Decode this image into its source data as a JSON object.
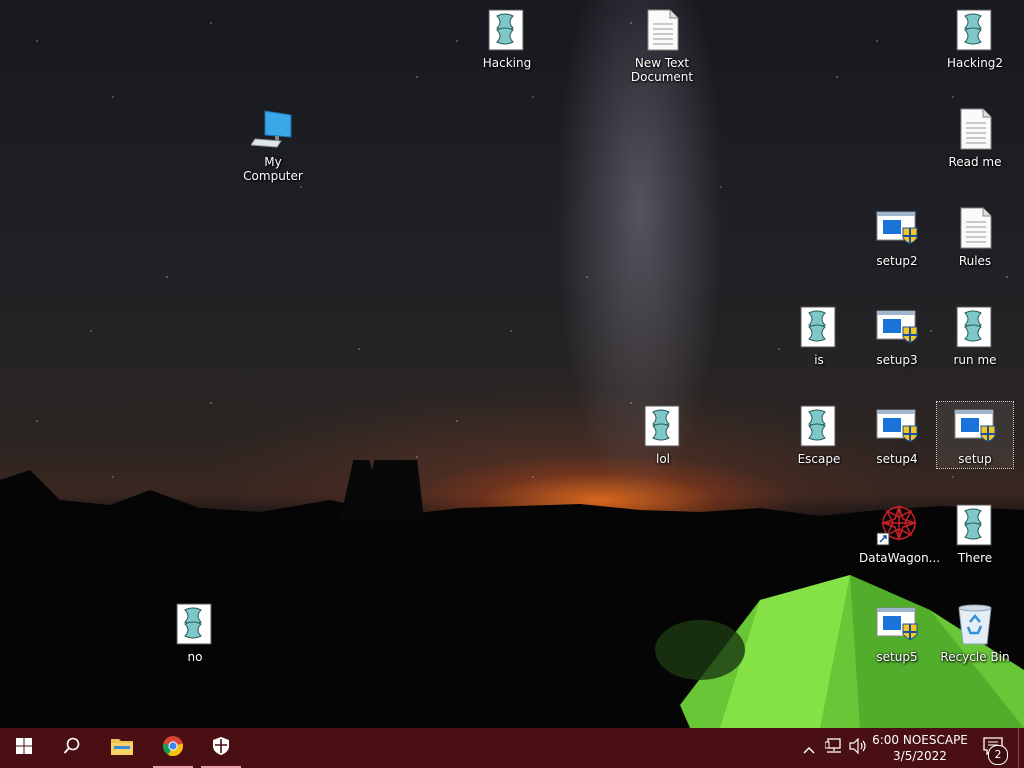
{
  "desktop": {
    "icons": [
      {
        "label": "Hacking",
        "type": "script"
      },
      {
        "label": "New Text Document",
        "type": "text"
      },
      {
        "label": "Hacking2",
        "type": "script"
      },
      {
        "label": "My Computer",
        "type": "computer"
      },
      {
        "label": "Read me",
        "type": "text"
      },
      {
        "label": "setup2",
        "type": "installer"
      },
      {
        "label": "Rules",
        "type": "text"
      },
      {
        "label": "is",
        "type": "script"
      },
      {
        "label": "setup3",
        "type": "installer"
      },
      {
        "label": "run me",
        "type": "script"
      },
      {
        "label": "lol",
        "type": "script"
      },
      {
        "label": "Escape",
        "type": "script"
      },
      {
        "label": "setup4",
        "type": "installer"
      },
      {
        "label": "setup",
        "type": "installer"
      },
      {
        "label": "DataWagon...",
        "type": "shortcut-star"
      },
      {
        "label": "There",
        "type": "script"
      },
      {
        "label": "no",
        "type": "script"
      },
      {
        "label": "setup5",
        "type": "installer"
      },
      {
        "label": "Recycle Bin",
        "type": "recycle-bin"
      }
    ]
  },
  "taskbar": {
    "color": "#4a0f12",
    "buttons": [
      "windows-start-icon",
      "search-icon",
      "file-explorer-icon",
      "chrome-icon",
      "defender-shield-icon"
    ],
    "tray": [
      "show-hidden-chevron-icon",
      "network-icon",
      "volume-icon"
    ],
    "clock": {
      "time": "6:00 NOESCAPE",
      "date": "3/5/2022"
    },
    "notifications": {
      "count": "2"
    }
  }
}
